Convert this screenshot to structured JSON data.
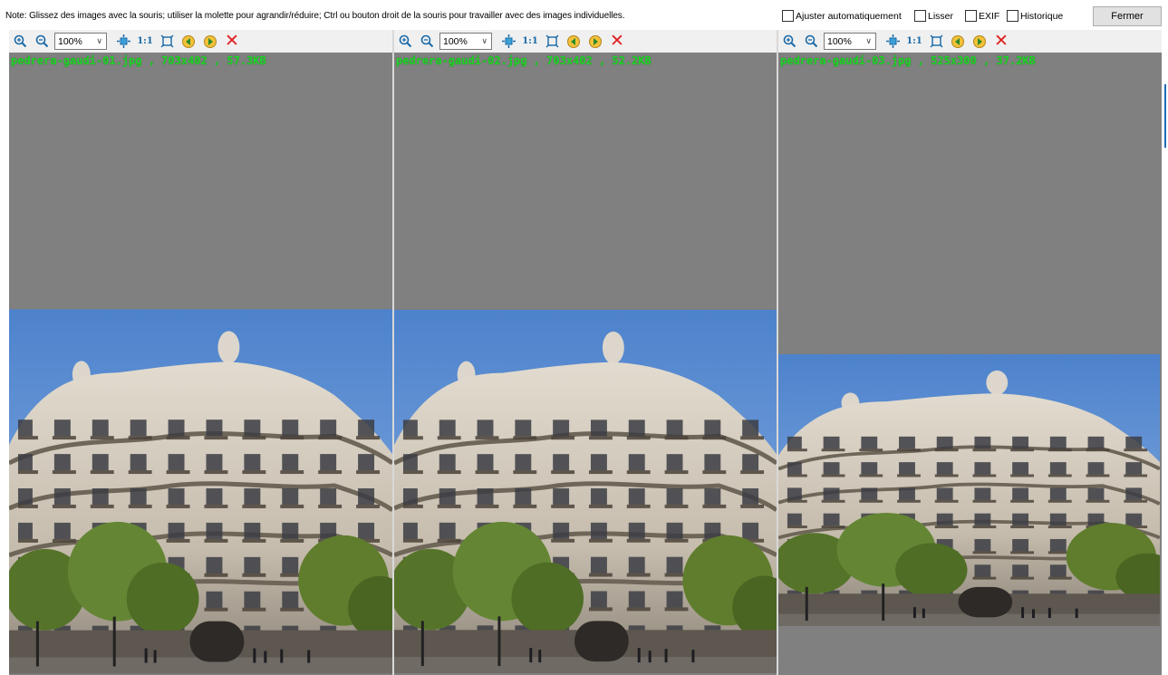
{
  "note": "Note: Glissez des images avec la souris; utiliser la molette pour agrandir/réduire; Ctrl ou bouton droit de la souris pour travailler avec des images individuelles.",
  "options": {
    "auto_fit": "Ajuster automatiquement",
    "smooth": "Lisser",
    "exif": "EXIF",
    "history": "Historique"
  },
  "close_label": "Fermer",
  "panes": [
    {
      "zoom": "100%",
      "one_to_one": "1:1",
      "caption": "pedrera-gaudi-01.jpg , 703x402 , 57.3KB"
    },
    {
      "zoom": "100%",
      "one_to_one": "1:1",
      "caption": "pedrera-gaudi-02.jpg , 703x402 , 52.2KB"
    },
    {
      "zoom": "100%",
      "one_to_one": "1:1",
      "caption": "pedrera-gaudi-03.jpg , 525x300 , 37.2KB"
    }
  ],
  "colors": {
    "viewport_bg": "#808080",
    "caption": "#22d52a",
    "sky": "#5b8fd3",
    "building": "#cfc6b8",
    "trees": "#5f7d2c"
  },
  "icons": [
    "zoom-in-icon",
    "zoom-out-icon",
    "fit-icon",
    "fullscreen-icon",
    "prev-image-icon",
    "next-image-icon",
    "close-icon"
  ]
}
